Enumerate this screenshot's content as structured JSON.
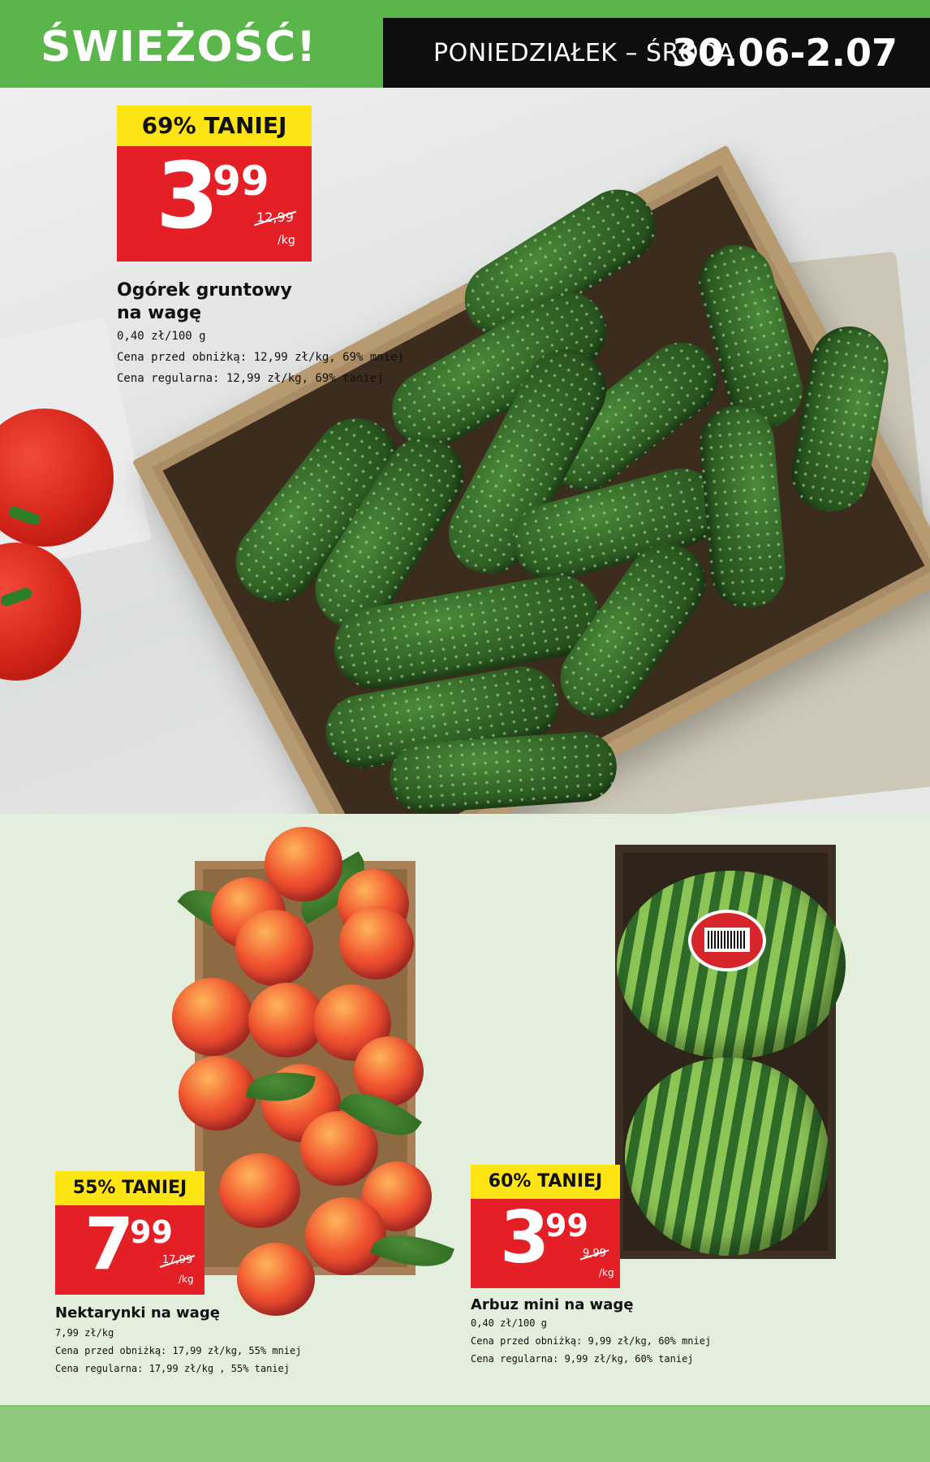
{
  "header": {
    "brand": "ŚWIEŻOŚĆ!",
    "days": "PONIEDZIAŁEK – ŚRODA",
    "date_range": "30.06-2.07"
  },
  "colors": {
    "brand_green": "#5ab64a",
    "badge_yellow": "#ffe414",
    "badge_red": "#e41f26",
    "header_black": "#0e0e0e"
  },
  "products": [
    {
      "discount": "69% TANIEJ",
      "price_int": "3",
      "price_dec": "99",
      "old_price": "12,99",
      "unit": "/kg",
      "title_line1": "Ogórek gruntowy",
      "title_line2": "na wagę",
      "details": [
        "0,40 zł/100 g",
        "Cena przed obniżką: 12,99 zł/kg, 69% mniej",
        "Cena regularna: 12,99 zł/kg, 69% taniej"
      ]
    },
    {
      "discount": "55% TANIEJ",
      "price_int": "7",
      "price_dec": "99",
      "old_price": "17,99",
      "unit": "/kg",
      "title_line1": "Nektarynki na wagę",
      "details": [
        "7,99 zł/kg",
        "Cena przed obniżką: 17,99 zł/kg, 55% mniej",
        "Cena regularna: 17,99 zł/kg , 55% taniej"
      ]
    },
    {
      "discount": "60% TANIEJ",
      "price_int": "3",
      "price_dec": "99",
      "old_price": "9,99",
      "unit": "/kg",
      "title_line1": "Arbuz mini na wagę",
      "details": [
        "0,40 zł/100 g",
        "Cena przed obniżką: 9,99 zł/kg, 60% mniej",
        "Cena regularna: 9,99 zł/kg, 60% taniej"
      ]
    }
  ]
}
